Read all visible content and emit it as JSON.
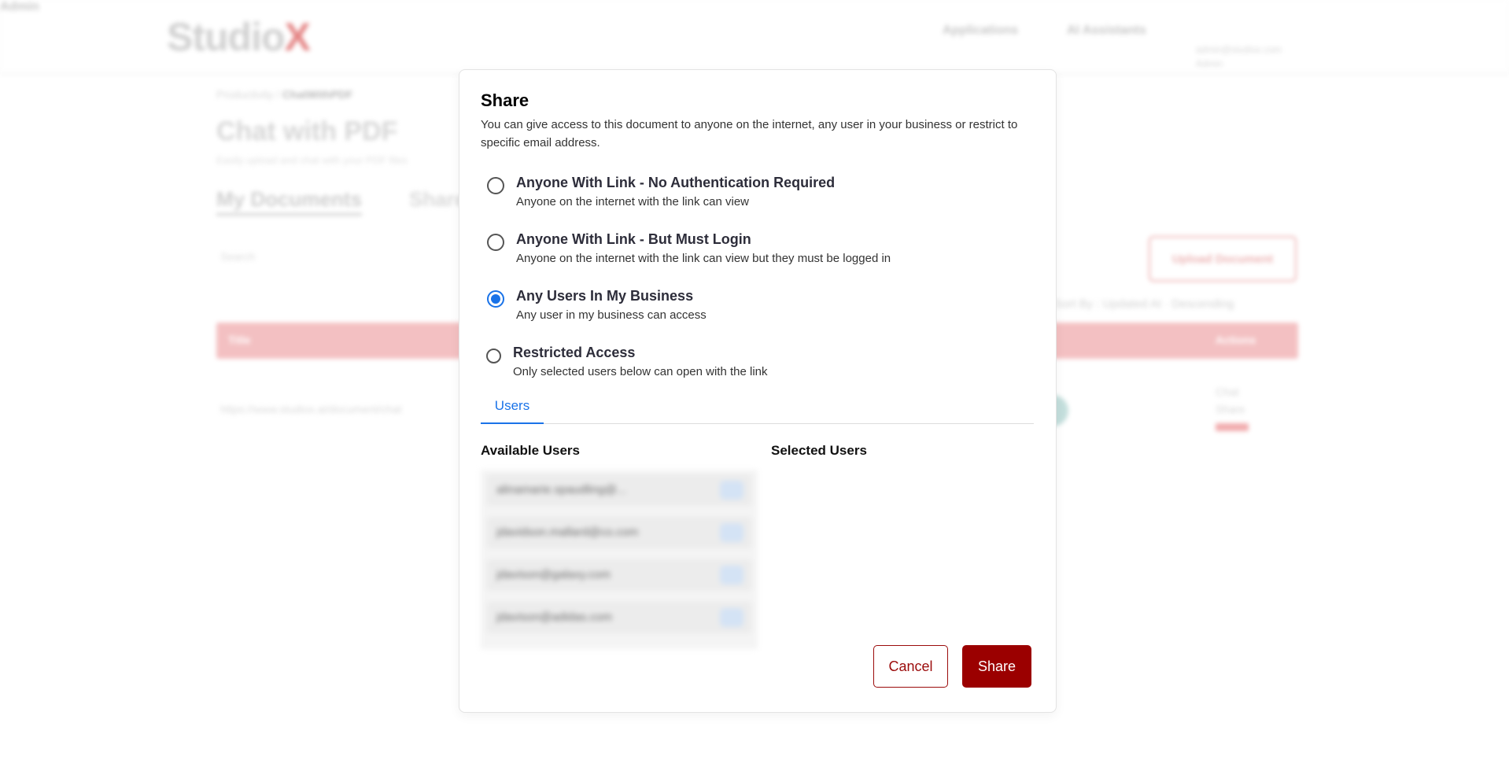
{
  "background": {
    "logo": {
      "text": "Studio",
      "accent": "X"
    },
    "nav": {
      "applications": "Applications",
      "ai_assistants": "AI Assistants",
      "user_name": "Admin",
      "user_email": "admin@studiox.com",
      "user_role": "Admin"
    },
    "breadcrumb": {
      "parent": "Productivity",
      "current": "ChatWithPDF"
    },
    "page_title": "Chat with PDF",
    "page_subtitle": "Easily upload and chat with your PDF files",
    "tabs": [
      "My Documents",
      "Shared"
    ],
    "search_placeholder": "Search",
    "upload_button": "Upload Document",
    "sort": "Sort By : Updated At  ·  Descending",
    "table_headers": {
      "title": "Title",
      "action": "Actions"
    },
    "row": {
      "link": "https://www.studiox.ai/document/chat",
      "chat": "Chat",
      "share": "Share"
    }
  },
  "modal": {
    "title": "Share",
    "description": "You can give access to this document to anyone on the internet, any user in your business or restrict to specific email address.",
    "options": [
      {
        "label": "Anyone With Link - No Authentication Required",
        "description": "Anyone on the internet with the link can view",
        "checked": false
      },
      {
        "label": "Anyone With Link - But Must Login",
        "description": "Anyone on the internet with the link can view but they must be logged in",
        "checked": false
      },
      {
        "label": "Any Users In My Business",
        "description": "Any user in my business can access",
        "checked": true
      },
      {
        "label": "Restricted Access",
        "description": "Only selected users below can open with the link",
        "checked": false
      }
    ],
    "tab_label": "Users",
    "available_users_heading": "Available Users",
    "selected_users_heading": "Selected Users",
    "available_users": [
      "alinamarie.spaudling@...",
      "jdavidson.mallard@co.com",
      "jdavison@galaxy.com",
      "jdavison@adidas.com"
    ],
    "cancel_label": "Cancel",
    "share_label": "Share"
  },
  "colors": {
    "primary": "#9b0000",
    "accent_blue": "#1a73e8"
  }
}
